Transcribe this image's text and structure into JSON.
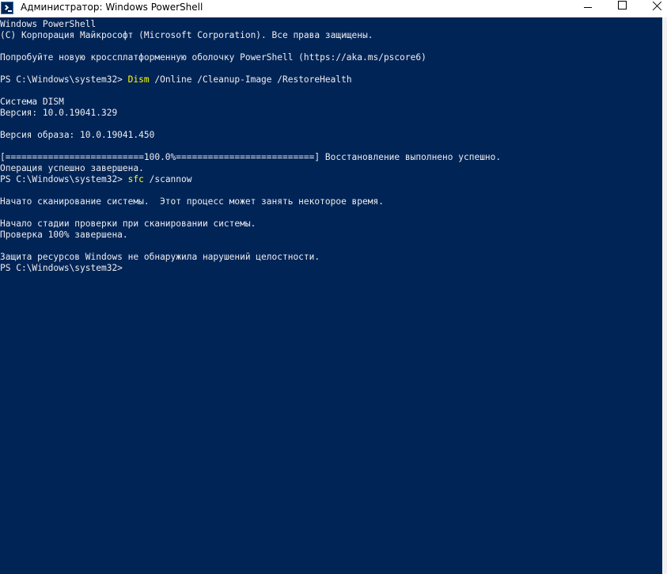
{
  "window": {
    "title": "Администратор: Windows PowerShell",
    "icon": "powershell-icon",
    "controls": {
      "minimize": "minimize-icon",
      "maximize": "maximize-icon",
      "close": "close-icon"
    }
  },
  "colors": {
    "console_bg": "#012456",
    "console_text": "#eeedf0",
    "command_highlight": "#ffff00"
  },
  "console": {
    "lines": [
      {
        "text": "Windows PowerShell"
      },
      {
        "text": "(C) Корпорация Майкрософт (Microsoft Corporation). Все права защищены."
      },
      {
        "text": ""
      },
      {
        "text": "Попробуйте новую кроссплатформенную оболочку PowerShell (https://aka.ms/pscore6)"
      },
      {
        "text": ""
      },
      {
        "prompt": "PS C:\\Windows\\system32> ",
        "cmd": "Dism",
        "args": " /Online /Cleanup-Image /RestoreHealth"
      },
      {
        "text": ""
      },
      {
        "text": "Система DISM"
      },
      {
        "text": "Версия: 10.0.19041.329"
      },
      {
        "text": ""
      },
      {
        "text": "Версия образа: 10.0.19041.450"
      },
      {
        "text": ""
      },
      {
        "text": "[==========================100.0%==========================] Восстановление выполнено успешно."
      },
      {
        "text": "Операция успешно завершена."
      },
      {
        "prompt": "PS C:\\Windows\\system32> ",
        "cmd": "sfc",
        "args": " /scannow"
      },
      {
        "text": ""
      },
      {
        "text": "Начато сканирование системы.  Этот процесс может занять некоторое время."
      },
      {
        "text": ""
      },
      {
        "text": "Начало стадии проверки при сканировании системы."
      },
      {
        "text": "Проверка 100% завершена."
      },
      {
        "text": ""
      },
      {
        "text": "Защита ресурсов Windows не обнаружила нарушений целостности."
      },
      {
        "prompt": "PS C:\\Windows\\system32> ",
        "cmd": "",
        "args": ""
      }
    ]
  }
}
